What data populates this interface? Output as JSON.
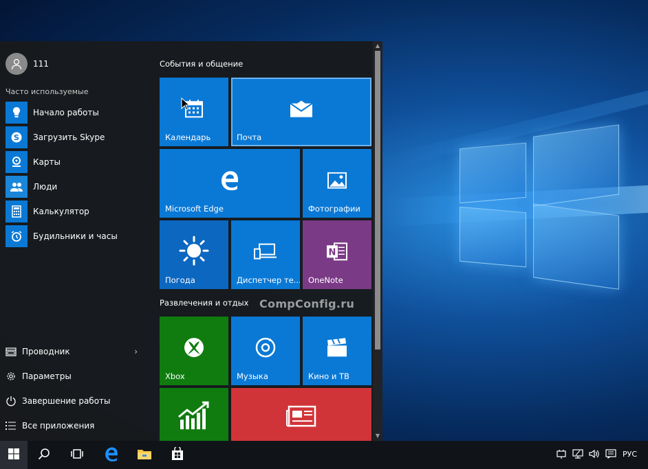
{
  "start_menu": {
    "user": {
      "name": "111"
    },
    "most_used_label": "Часто используемые",
    "apps": [
      {
        "label": "Начало работы",
        "icon": "lightbulb-icon",
        "color": "#0a79d6"
      },
      {
        "label": "Загрузить Skype",
        "icon": "skype-icon",
        "color": "#0a79d6"
      },
      {
        "label": "Карты",
        "icon": "maps-icon",
        "color": "#0a79d6"
      },
      {
        "label": "Люди",
        "icon": "people-icon",
        "color": "#0a79d6"
      },
      {
        "label": "Калькулятор",
        "icon": "calculator-icon",
        "color": "#0a79d6"
      },
      {
        "label": "Будильники и часы",
        "icon": "alarm-clock-icon",
        "color": "#0a79d6"
      }
    ],
    "bottom": {
      "explorer": "Проводник",
      "settings": "Параметры",
      "power": "Завершение работы",
      "all_apps": "Все приложения"
    },
    "groups": [
      {
        "title": "События и общение",
        "tiles": [
          {
            "label": "Календарь",
            "icon": "calendar-icon",
            "color": "#0a79d6"
          },
          {
            "label": "Почта",
            "icon": "mail-icon",
            "color": "#0a79d6"
          },
          {
            "label": "Microsoft Edge",
            "icon": "edge-icon",
            "color": "#0a79d6"
          },
          {
            "label": "Фотографии",
            "icon": "photos-icon",
            "color": "#0a79d6"
          },
          {
            "label": "Погода",
            "icon": "weather-sun-icon",
            "color": "#0c67c0"
          },
          {
            "label": "Диспетчер те...",
            "icon": "phone-companion-icon",
            "color": "#0a79d6"
          },
          {
            "label": "OneNote",
            "icon": "onenote-icon",
            "color": "#7b3a85"
          }
        ]
      },
      {
        "title": "Развлечения и отдых",
        "tiles": [
          {
            "label": "Xbox",
            "icon": "xbox-icon",
            "color": "#107c10"
          },
          {
            "label": "Музыка",
            "icon": "music-icon",
            "color": "#0a79d6"
          },
          {
            "label": "Кино и ТВ",
            "icon": "movies-icon",
            "color": "#0a79d6"
          },
          {
            "label": "",
            "icon": "money-chart-icon",
            "color": "#107c10"
          },
          {
            "label": "",
            "icon": "news-icon",
            "color": "#d13438"
          }
        ]
      }
    ],
    "watermark": "CompConfig.ru"
  },
  "taskbar": {
    "language": "РУС",
    "pinned": [
      "start-icon",
      "search-icon",
      "task-view-icon",
      "edge-icon",
      "file-explorer-icon",
      "store-icon"
    ]
  }
}
